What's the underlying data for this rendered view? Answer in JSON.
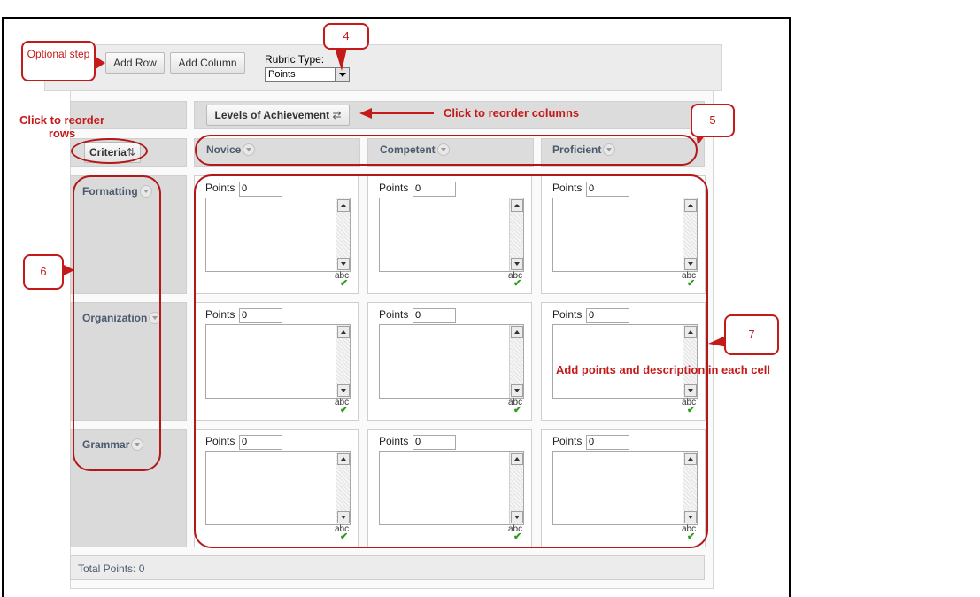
{
  "toolbar": {
    "add_row": "Add Row",
    "add_column": "Add Column",
    "rubric_type_label": "Rubric Type:",
    "rubric_type_value": "Points"
  },
  "rubric": {
    "levels_button": "Levels of Achievement",
    "criteria_button": "Criteria",
    "levels": [
      "Novice",
      "Competent",
      "Proficient"
    ],
    "criteria": [
      "Formatting",
      "Organization",
      "Grammar"
    ],
    "points_label": "Points",
    "default_points": "0",
    "spell_check": "abc",
    "total_points": "Total Points: 0"
  },
  "annotations": {
    "optional_step": "Optional step",
    "callout_4": "4",
    "callout_5": "5",
    "callout_6": "6",
    "callout_7": "7",
    "reorder_rows": "Click to reorder rows",
    "reorder_columns": "Click to reorder columns",
    "add_points": "Add points and description in each cell"
  },
  "colors": {
    "annotation_red": "#c41a1a",
    "level_text": "#4b5a6e",
    "check_green": "#2e9b1e"
  }
}
